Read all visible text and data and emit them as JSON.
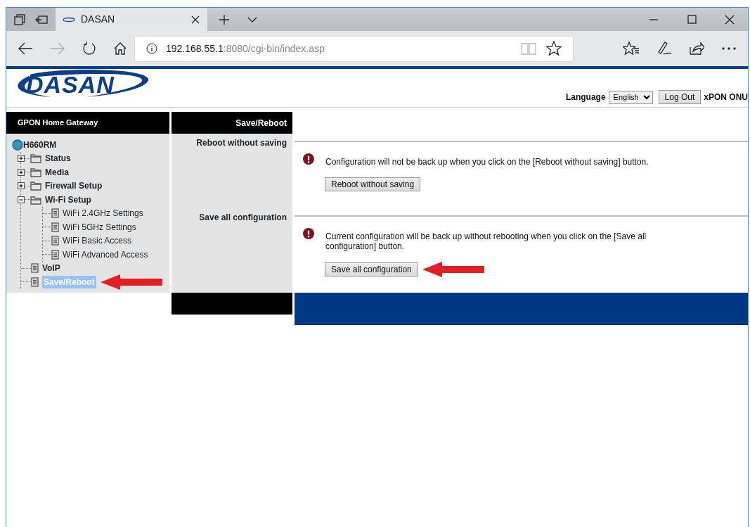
{
  "browser": {
    "tabs": [
      {
        "title": "DASAN",
        "selected": true
      }
    ],
    "address": {
      "host": "192.168.55.1",
      "rest": ":8080/cgi-bin/index.asp"
    },
    "forward_disabled": true,
    "reading_view_disabled": true
  },
  "header": {
    "logo": "DASAN",
    "language_label": "Language",
    "language_value": "English",
    "logout_button": "Log Out",
    "product": "xPON ONU"
  },
  "sidebar": {
    "title": "GPON Home Gateway",
    "root": "H660RM",
    "items": [
      {
        "label": "Status",
        "kind": "folder",
        "expanded": false,
        "selected": false
      },
      {
        "label": "Media",
        "kind": "folder",
        "expanded": false,
        "selected": false
      },
      {
        "label": "Firewall Setup",
        "kind": "folder",
        "expanded": false,
        "selected": false
      },
      {
        "label": "Wi-Fi Setup",
        "kind": "folder",
        "expanded": true,
        "selected": false,
        "children": [
          {
            "label": "WiFi 2.4GHz Settings",
            "kind": "page",
            "selected": false
          },
          {
            "label": "WiFi 5GHz Settings",
            "kind": "page",
            "selected": false
          },
          {
            "label": "WiFi Basic Access",
            "kind": "page",
            "selected": false
          },
          {
            "label": "WiFi Advanced Access",
            "kind": "page",
            "selected": false
          }
        ]
      },
      {
        "label": "VoIP",
        "kind": "page",
        "selected": false
      },
      {
        "label": "Save/Reboot",
        "kind": "page",
        "selected": true,
        "arrow": true
      }
    ]
  },
  "content": {
    "title": "Save/Reboot",
    "sections": [
      {
        "label": "Reboot without saving",
        "message": "Configuration will not be back up when you click on the [Reboot without saving] button.",
        "button": "Reboot without saving",
        "arrow": false
      },
      {
        "label": "Save all configuration",
        "message": "Current configuration will be back up without rebooting when you click on the [Save all configuration] button.",
        "button": "Save all configuration",
        "arrow": true
      }
    ]
  }
}
